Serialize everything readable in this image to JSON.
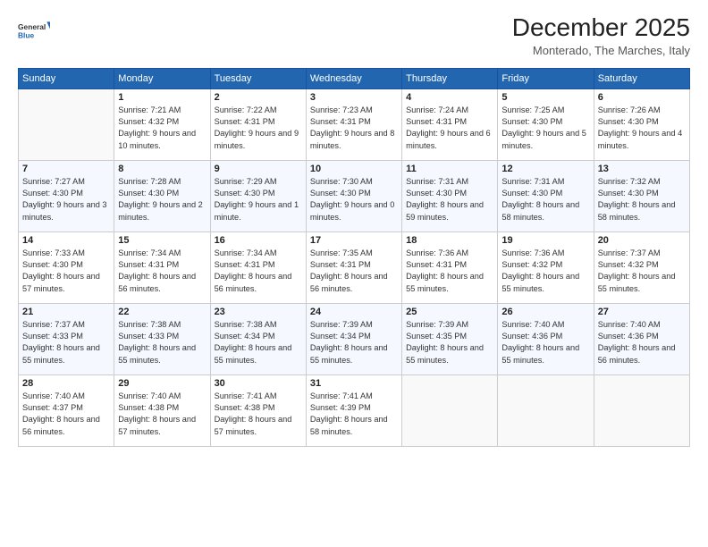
{
  "header": {
    "logo_line1": "General",
    "logo_line2": "Blue",
    "month_title": "December 2025",
    "location": "Monterado, The Marches, Italy"
  },
  "days_of_week": [
    "Sunday",
    "Monday",
    "Tuesday",
    "Wednesday",
    "Thursday",
    "Friday",
    "Saturday"
  ],
  "weeks": [
    [
      {
        "day": "",
        "empty": true
      },
      {
        "day": "1",
        "sunrise": "7:21 AM",
        "sunset": "4:32 PM",
        "daylight": "9 hours and 10 minutes."
      },
      {
        "day": "2",
        "sunrise": "7:22 AM",
        "sunset": "4:31 PM",
        "daylight": "9 hours and 9 minutes."
      },
      {
        "day": "3",
        "sunrise": "7:23 AM",
        "sunset": "4:31 PM",
        "daylight": "9 hours and 8 minutes."
      },
      {
        "day": "4",
        "sunrise": "7:24 AM",
        "sunset": "4:31 PM",
        "daylight": "9 hours and 6 minutes."
      },
      {
        "day": "5",
        "sunrise": "7:25 AM",
        "sunset": "4:30 PM",
        "daylight": "9 hours and 5 minutes."
      },
      {
        "day": "6",
        "sunrise": "7:26 AM",
        "sunset": "4:30 PM",
        "daylight": "9 hours and 4 minutes."
      }
    ],
    [
      {
        "day": "7",
        "sunrise": "7:27 AM",
        "sunset": "4:30 PM",
        "daylight": "9 hours and 3 minutes."
      },
      {
        "day": "8",
        "sunrise": "7:28 AM",
        "sunset": "4:30 PM",
        "daylight": "9 hours and 2 minutes."
      },
      {
        "day": "9",
        "sunrise": "7:29 AM",
        "sunset": "4:30 PM",
        "daylight": "9 hours and 1 minute."
      },
      {
        "day": "10",
        "sunrise": "7:30 AM",
        "sunset": "4:30 PM",
        "daylight": "9 hours and 0 minutes."
      },
      {
        "day": "11",
        "sunrise": "7:31 AM",
        "sunset": "4:30 PM",
        "daylight": "8 hours and 59 minutes."
      },
      {
        "day": "12",
        "sunrise": "7:31 AM",
        "sunset": "4:30 PM",
        "daylight": "8 hours and 58 minutes."
      },
      {
        "day": "13",
        "sunrise": "7:32 AM",
        "sunset": "4:30 PM",
        "daylight": "8 hours and 58 minutes."
      }
    ],
    [
      {
        "day": "14",
        "sunrise": "7:33 AM",
        "sunset": "4:30 PM",
        "daylight": "8 hours and 57 minutes."
      },
      {
        "day": "15",
        "sunrise": "7:34 AM",
        "sunset": "4:31 PM",
        "daylight": "8 hours and 56 minutes."
      },
      {
        "day": "16",
        "sunrise": "7:34 AM",
        "sunset": "4:31 PM",
        "daylight": "8 hours and 56 minutes."
      },
      {
        "day": "17",
        "sunrise": "7:35 AM",
        "sunset": "4:31 PM",
        "daylight": "8 hours and 56 minutes."
      },
      {
        "day": "18",
        "sunrise": "7:36 AM",
        "sunset": "4:31 PM",
        "daylight": "8 hours and 55 minutes."
      },
      {
        "day": "19",
        "sunrise": "7:36 AM",
        "sunset": "4:32 PM",
        "daylight": "8 hours and 55 minutes."
      },
      {
        "day": "20",
        "sunrise": "7:37 AM",
        "sunset": "4:32 PM",
        "daylight": "8 hours and 55 minutes."
      }
    ],
    [
      {
        "day": "21",
        "sunrise": "7:37 AM",
        "sunset": "4:33 PM",
        "daylight": "8 hours and 55 minutes."
      },
      {
        "day": "22",
        "sunrise": "7:38 AM",
        "sunset": "4:33 PM",
        "daylight": "8 hours and 55 minutes."
      },
      {
        "day": "23",
        "sunrise": "7:38 AM",
        "sunset": "4:34 PM",
        "daylight": "8 hours and 55 minutes."
      },
      {
        "day": "24",
        "sunrise": "7:39 AM",
        "sunset": "4:34 PM",
        "daylight": "8 hours and 55 minutes."
      },
      {
        "day": "25",
        "sunrise": "7:39 AM",
        "sunset": "4:35 PM",
        "daylight": "8 hours and 55 minutes."
      },
      {
        "day": "26",
        "sunrise": "7:40 AM",
        "sunset": "4:36 PM",
        "daylight": "8 hours and 55 minutes."
      },
      {
        "day": "27",
        "sunrise": "7:40 AM",
        "sunset": "4:36 PM",
        "daylight": "8 hours and 56 minutes."
      }
    ],
    [
      {
        "day": "28",
        "sunrise": "7:40 AM",
        "sunset": "4:37 PM",
        "daylight": "8 hours and 56 minutes."
      },
      {
        "day": "29",
        "sunrise": "7:40 AM",
        "sunset": "4:38 PM",
        "daylight": "8 hours and 57 minutes."
      },
      {
        "day": "30",
        "sunrise": "7:41 AM",
        "sunset": "4:38 PM",
        "daylight": "8 hours and 57 minutes."
      },
      {
        "day": "31",
        "sunrise": "7:41 AM",
        "sunset": "4:39 PM",
        "daylight": "8 hours and 58 minutes."
      },
      {
        "day": "",
        "empty": true
      },
      {
        "day": "",
        "empty": true
      },
      {
        "day": "",
        "empty": true
      }
    ]
  ]
}
